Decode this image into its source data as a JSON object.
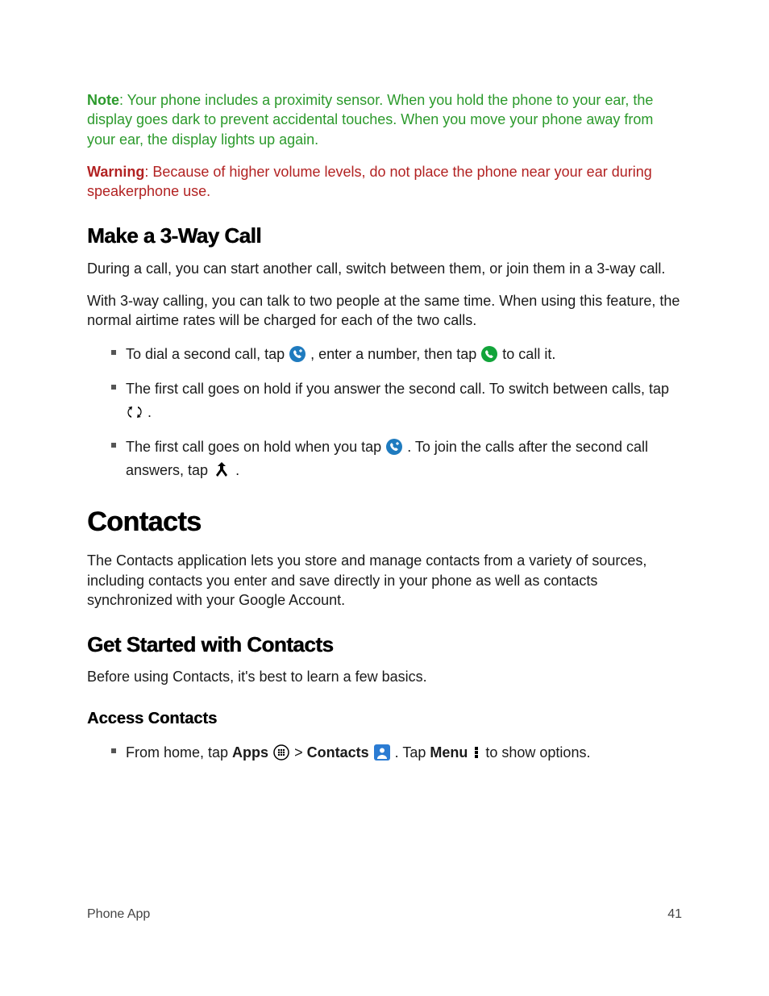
{
  "note": {
    "label": "Note",
    "text": ": Your phone includes a proximity sensor. When you hold the phone to your ear, the display goes dark to prevent accidental touches. When you move your phone away from your ear, the display lights up again."
  },
  "warning": {
    "label": "Warning",
    "text": ": Because of higher volume levels, do not place the phone near your ear during speakerphone use."
  },
  "s1": {
    "heading": "Make a 3-Way Call",
    "p1": "During a call, you can start another call, switch between them, or join them in a 3-way call.",
    "p2": "With 3-way calling, you can talk to two people at the same time. When using this feature, the normal airtime rates will be charged for each of the two calls.",
    "li1a": "To dial a second call, tap ",
    "li1b": ", enter a number, then tap ",
    "li1c": " to call it.",
    "li2a": "The first call goes on hold if you answer the second call. To switch between calls, tap ",
    "li2b": ".",
    "li3a": "The first call goes on hold when you tap ",
    "li3b": ". To join the calls after the second call answers, tap ",
    "li3c": "."
  },
  "s2": {
    "heading": "Contacts",
    "p1": "The Contacts application lets you store and manage contacts from a variety of sources, including contacts you enter and save directly in your phone as well as contacts synchronized with your Google Account."
  },
  "s3": {
    "heading": "Get Started with Contacts",
    "p1": "Before using Contacts, it's best to learn a few basics."
  },
  "s4": {
    "heading": "Access Contacts",
    "li1a": "From home, tap ",
    "li1b": "Apps",
    "li1c": " > ",
    "li1d": "Contacts",
    "li1e": ". Tap ",
    "li1f": "Menu",
    "li1g": " to show options."
  },
  "footer": {
    "left": "Phone App",
    "right": "41"
  }
}
